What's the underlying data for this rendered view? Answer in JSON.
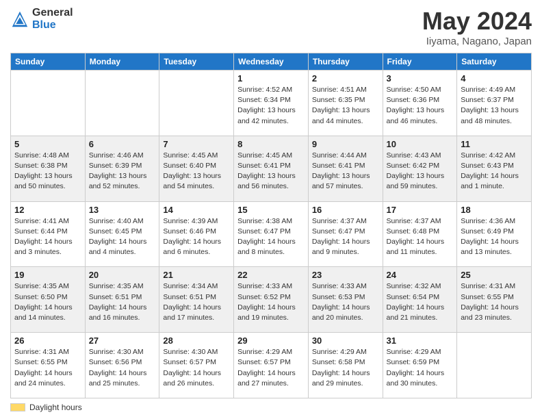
{
  "logo": {
    "line1": "General",
    "line2": "Blue"
  },
  "title": "May 2024",
  "location": "Iiyama, Nagano, Japan",
  "days_of_week": [
    "Sunday",
    "Monday",
    "Tuesday",
    "Wednesday",
    "Thursday",
    "Friday",
    "Saturday"
  ],
  "footer_label": "Daylight hours",
  "weeks": [
    [
      {
        "day": "",
        "info": ""
      },
      {
        "day": "",
        "info": ""
      },
      {
        "day": "",
        "info": ""
      },
      {
        "day": "1",
        "info": "Sunrise: 4:52 AM\nSunset: 6:34 PM\nDaylight: 13 hours\nand 42 minutes."
      },
      {
        "day": "2",
        "info": "Sunrise: 4:51 AM\nSunset: 6:35 PM\nDaylight: 13 hours\nand 44 minutes."
      },
      {
        "day": "3",
        "info": "Sunrise: 4:50 AM\nSunset: 6:36 PM\nDaylight: 13 hours\nand 46 minutes."
      },
      {
        "day": "4",
        "info": "Sunrise: 4:49 AM\nSunset: 6:37 PM\nDaylight: 13 hours\nand 48 minutes."
      }
    ],
    [
      {
        "day": "5",
        "info": "Sunrise: 4:48 AM\nSunset: 6:38 PM\nDaylight: 13 hours\nand 50 minutes."
      },
      {
        "day": "6",
        "info": "Sunrise: 4:46 AM\nSunset: 6:39 PM\nDaylight: 13 hours\nand 52 minutes."
      },
      {
        "day": "7",
        "info": "Sunrise: 4:45 AM\nSunset: 6:40 PM\nDaylight: 13 hours\nand 54 minutes."
      },
      {
        "day": "8",
        "info": "Sunrise: 4:45 AM\nSunset: 6:41 PM\nDaylight: 13 hours\nand 56 minutes."
      },
      {
        "day": "9",
        "info": "Sunrise: 4:44 AM\nSunset: 6:41 PM\nDaylight: 13 hours\nand 57 minutes."
      },
      {
        "day": "10",
        "info": "Sunrise: 4:43 AM\nSunset: 6:42 PM\nDaylight: 13 hours\nand 59 minutes."
      },
      {
        "day": "11",
        "info": "Sunrise: 4:42 AM\nSunset: 6:43 PM\nDaylight: 14 hours\nand 1 minute."
      }
    ],
    [
      {
        "day": "12",
        "info": "Sunrise: 4:41 AM\nSunset: 6:44 PM\nDaylight: 14 hours\nand 3 minutes."
      },
      {
        "day": "13",
        "info": "Sunrise: 4:40 AM\nSunset: 6:45 PM\nDaylight: 14 hours\nand 4 minutes."
      },
      {
        "day": "14",
        "info": "Sunrise: 4:39 AM\nSunset: 6:46 PM\nDaylight: 14 hours\nand 6 minutes."
      },
      {
        "day": "15",
        "info": "Sunrise: 4:38 AM\nSunset: 6:47 PM\nDaylight: 14 hours\nand 8 minutes."
      },
      {
        "day": "16",
        "info": "Sunrise: 4:37 AM\nSunset: 6:47 PM\nDaylight: 14 hours\nand 9 minutes."
      },
      {
        "day": "17",
        "info": "Sunrise: 4:37 AM\nSunset: 6:48 PM\nDaylight: 14 hours\nand 11 minutes."
      },
      {
        "day": "18",
        "info": "Sunrise: 4:36 AM\nSunset: 6:49 PM\nDaylight: 14 hours\nand 13 minutes."
      }
    ],
    [
      {
        "day": "19",
        "info": "Sunrise: 4:35 AM\nSunset: 6:50 PM\nDaylight: 14 hours\nand 14 minutes."
      },
      {
        "day": "20",
        "info": "Sunrise: 4:35 AM\nSunset: 6:51 PM\nDaylight: 14 hours\nand 16 minutes."
      },
      {
        "day": "21",
        "info": "Sunrise: 4:34 AM\nSunset: 6:51 PM\nDaylight: 14 hours\nand 17 minutes."
      },
      {
        "day": "22",
        "info": "Sunrise: 4:33 AM\nSunset: 6:52 PM\nDaylight: 14 hours\nand 19 minutes."
      },
      {
        "day": "23",
        "info": "Sunrise: 4:33 AM\nSunset: 6:53 PM\nDaylight: 14 hours\nand 20 minutes."
      },
      {
        "day": "24",
        "info": "Sunrise: 4:32 AM\nSunset: 6:54 PM\nDaylight: 14 hours\nand 21 minutes."
      },
      {
        "day": "25",
        "info": "Sunrise: 4:31 AM\nSunset: 6:55 PM\nDaylight: 14 hours\nand 23 minutes."
      }
    ],
    [
      {
        "day": "26",
        "info": "Sunrise: 4:31 AM\nSunset: 6:55 PM\nDaylight: 14 hours\nand 24 minutes."
      },
      {
        "day": "27",
        "info": "Sunrise: 4:30 AM\nSunset: 6:56 PM\nDaylight: 14 hours\nand 25 minutes."
      },
      {
        "day": "28",
        "info": "Sunrise: 4:30 AM\nSunset: 6:57 PM\nDaylight: 14 hours\nand 26 minutes."
      },
      {
        "day": "29",
        "info": "Sunrise: 4:29 AM\nSunset: 6:57 PM\nDaylight: 14 hours\nand 27 minutes."
      },
      {
        "day": "30",
        "info": "Sunrise: 4:29 AM\nSunset: 6:58 PM\nDaylight: 14 hours\nand 29 minutes."
      },
      {
        "day": "31",
        "info": "Sunrise: 4:29 AM\nSunset: 6:59 PM\nDaylight: 14 hours\nand 30 minutes."
      },
      {
        "day": "",
        "info": ""
      }
    ]
  ]
}
